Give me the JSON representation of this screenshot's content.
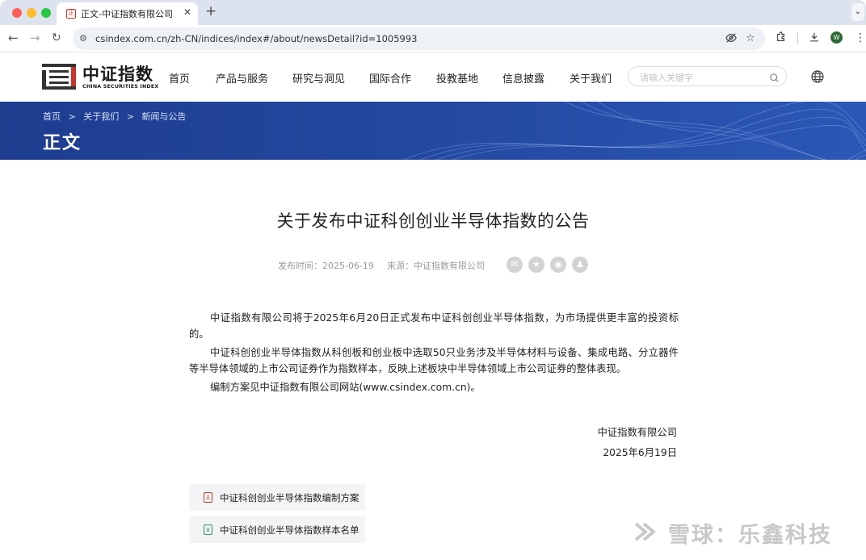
{
  "browser": {
    "tab_title": "正文-中证指数有限公司",
    "url": "csindex.com.cn/zh-CN/indices/index#/about/newsDetail?id=1005993",
    "profile_initial": "W"
  },
  "site": {
    "logo_cn": "中证指数",
    "logo_en": "CHINA SECURITIES INDEX",
    "nav": [
      "首页",
      "产品与服务",
      "研究与洞见",
      "国际合作",
      "投教基地",
      "信息披露",
      "关于我们"
    ],
    "search_placeholder": "请输入关键字"
  },
  "banner": {
    "breadcrumb": [
      "首页",
      ">",
      "关于我们",
      ">",
      "新闻与公告"
    ],
    "page_title": "正文"
  },
  "article": {
    "title": "关于发布中证科创创业半导体指数的公告",
    "publish_time": "发布时间：2025-06-19",
    "source": "来源：中证指数有限公司",
    "paragraphs": [
      "中证指数有限公司将于2025年6月20日正式发布中证科创创业半导体指数，为市场提供更丰富的投资标的。",
      "中证科创创业半导体指数从科创板和创业板中选取50只业务涉及半导体材料与设备、集成电路、分立器件等半导体领域的上市公司证券作为指数样本，反映上述板块中半导体领域上市公司证券的整体表现。",
      "编制方案见中证指数有限公司网站(www.csindex.com.cn)。"
    ],
    "signature_org": "中证指数有限公司",
    "signature_date": "2025年6月19日"
  },
  "attachments": [
    {
      "label": "中证科创创业半导体指数编制方案",
      "icon": "pdf-icon",
      "color": "#c8352b"
    },
    {
      "label": "中证科创创业半导体指数样本名单",
      "icon": "excel-icon",
      "color": "#2e8b57"
    }
  ],
  "watermark": {
    "text": "雪球：乐鑫科技"
  },
  "colors": {
    "banner": "#23479e",
    "brand_red": "#c8352b"
  }
}
